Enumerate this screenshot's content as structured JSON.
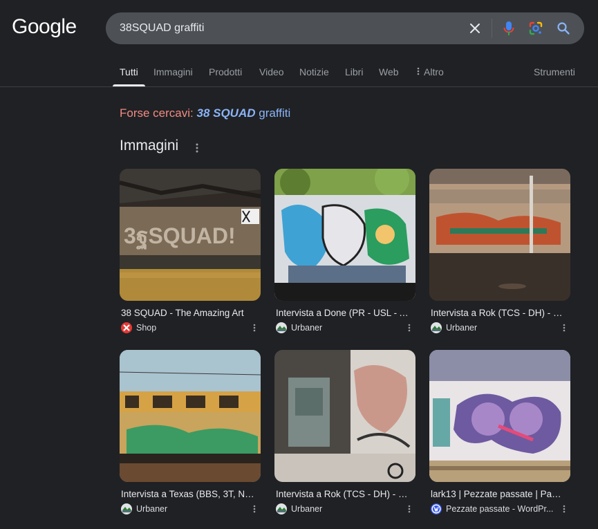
{
  "header": {
    "logo_text": "Google",
    "search_query": "38SQUAD graffiti"
  },
  "icons": {
    "clear": "close-icon",
    "voice": "microphone-icon",
    "lens": "google-lens-icon",
    "search": "search-icon"
  },
  "tabs": [
    {
      "label": "Tutti",
      "active": true
    },
    {
      "label": "Immagini"
    },
    {
      "label": "Prodotti"
    },
    {
      "label": "Video"
    },
    {
      "label": "Notizie"
    },
    {
      "label": "Libri"
    },
    {
      "label": "Web"
    },
    {
      "label": "Altro"
    }
  ],
  "tools_label": "Strumenti",
  "did_you_mean": {
    "label": "Forse cercavi:",
    "suggestion_bold": "38 SQUAD",
    "suggestion_rest": "graffiti"
  },
  "images_section": {
    "heading": "Immagini",
    "results": [
      {
        "title": "38 SQUAD - The Amazing Art",
        "source": "Shop"
      },
      {
        "title": "Intervista a Done (PR - USL - A...",
        "source": "Urbaner"
      },
      {
        "title": "Intervista a Rok (TCS - DH) - U...",
        "source": "Urbaner"
      },
      {
        "title": "Intervista a Texas (BBS, 3T, NE...",
        "source": "Urbaner"
      },
      {
        "title": "Intervista a Rok (TCS - DH) - U...",
        "source": "Urbaner"
      },
      {
        "title": "lark13 | Pezzate passate | Pagi...",
        "source": "Pezzate passate - WordPr..."
      }
    ]
  },
  "colors": {
    "background": "#202124",
    "link": "#8ab4f8",
    "did_you_mean_label": "#f28b82"
  }
}
